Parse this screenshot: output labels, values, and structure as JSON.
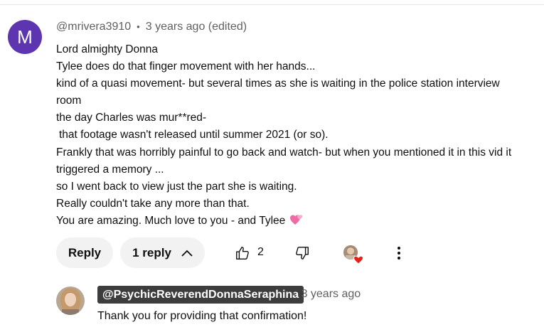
{
  "comment": {
    "avatar_letter": "M",
    "avatar_color": "#5e35b1",
    "author": "@mrivera3910",
    "separator": "•",
    "time": "3 years ago (edited)",
    "lines": [
      "Lord almighty Donna",
      "Tylee does do that finger movement with her hands...",
      "kind of a quasi movement- but several times as she is waiting in the police station interview",
      "room",
      "the day Charles was mur**red-",
      "that footage wasn't released until summer 2021 (or so).",
      "Frankly that was horribly painful to go back and watch- but when you mentioned it in this vid it",
      "triggered a memory ...",
      "so I went back to view just the part she is waiting.",
      "Really couldn't take any more than that.",
      "You are amazing.  Much love to you - and Tylee"
    ],
    "last_line_emoji": "two-hearts-icon"
  },
  "actions": {
    "reply_label": "Reply",
    "replies_label": "1 reply",
    "like_count": "2",
    "icons": [
      "chevron-up-icon",
      "thumbs-up-icon",
      "thumbs-down-icon",
      "creator-heart-icon",
      "more-vert-icon"
    ]
  },
  "reply": {
    "author": "@PsychicReverendDonnaSeraphina",
    "separator": "•",
    "time": "3 years ago",
    "text": "Thank you for providing that confirmation!",
    "author_badge_color": "#3d3d3d"
  }
}
